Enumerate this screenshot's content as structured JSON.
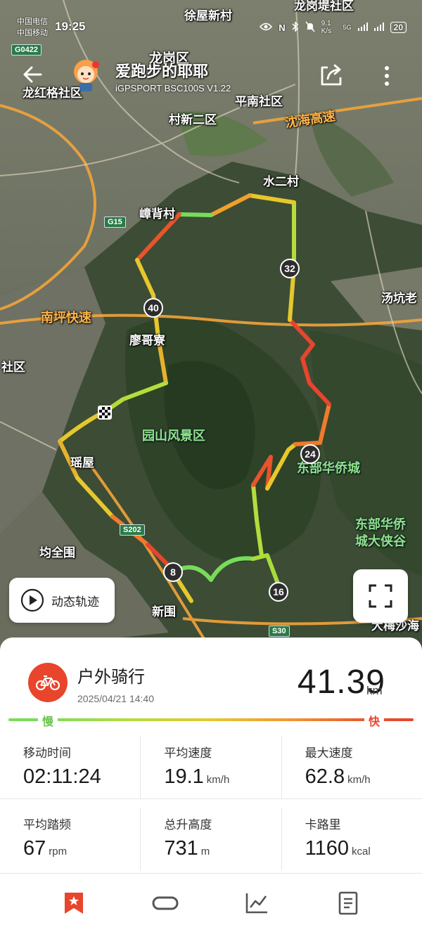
{
  "status_bar": {
    "carrier1": "中国电信",
    "carrier2": "中国移动",
    "time": "19:25",
    "net_speed": "9.1 K/s",
    "signal": "5G",
    "battery": "20"
  },
  "header": {
    "user_name": "爱跑步的耶耶",
    "device": "iGPSPORT BSC100S  V1.22"
  },
  "map": {
    "labels": [
      {
        "id": "xuwuxincun",
        "text": "徐屋新村",
        "style": "white"
      },
      {
        "id": "longgangdi",
        "text": "龙岗堤社区",
        "style": "white"
      },
      {
        "id": "longgangqu",
        "text": "龙岗区",
        "style": "white"
      },
      {
        "id": "longhongge",
        "text": "龙红格社区",
        "style": "white"
      },
      {
        "id": "pingnan",
        "text": "平南社区",
        "style": "white"
      },
      {
        "id": "cunxin",
        "text": "村新二区",
        "style": "white"
      },
      {
        "id": "shenhai",
        "text": "沈海高速",
        "style": "orange"
      },
      {
        "id": "shuiercun",
        "text": "水二村",
        "style": "white"
      },
      {
        "id": "zhangbeicun",
        "text": "嶂背村",
        "style": "white"
      },
      {
        "id": "nanping",
        "text": "南坪快速",
        "style": "orange"
      },
      {
        "id": "tangkeng",
        "text": "汤坑老",
        "style": "white"
      },
      {
        "id": "liaoge",
        "text": "廖哥寮",
        "style": "white"
      },
      {
        "id": "shequ",
        "text": "社区",
        "style": "white"
      },
      {
        "id": "yuanshan",
        "text": "园山风景区",
        "style": "green"
      },
      {
        "id": "fanwu",
        "text": "瑶屋",
        "style": "white"
      },
      {
        "id": "dongbuhq",
        "text": "东部华侨城",
        "style": "green"
      },
      {
        "id": "dongbuhq2a",
        "text": "东部华侨",
        "style": "green"
      },
      {
        "id": "dongbuhq2b",
        "text": "城大侠谷",
        "style": "green"
      },
      {
        "id": "junquanwei",
        "text": "均全围",
        "style": "white"
      },
      {
        "id": "xinwei",
        "text": "新围",
        "style": "white"
      },
      {
        "id": "dameisha",
        "text": "大梅沙海",
        "style": "white"
      }
    ],
    "shields": {
      "g0422": "G0422",
      "g15": "G15",
      "s202": "S202",
      "s30": "S30"
    },
    "km_markers": {
      "m8": "8",
      "m16": "16",
      "m24": "24",
      "m32": "32",
      "m40": "40"
    },
    "replay_label": "动态轨迹"
  },
  "summary": {
    "sport_type": "户外骑行",
    "datetime": "2025/04/21 14:40",
    "distance": "41.39",
    "distance_unit": "km",
    "speed_slow": "慢",
    "speed_fast": "快"
  },
  "stats": [
    {
      "label": "移动时间",
      "value": "02:11:24",
      "unit": ""
    },
    {
      "label": "平均速度",
      "value": "19.1",
      "unit": "km/h"
    },
    {
      "label": "最大速度",
      "value": "62.8",
      "unit": "km/h"
    },
    {
      "label": "平均踏频",
      "value": "67",
      "unit": "rpm"
    },
    {
      "label": "总升高度",
      "value": "731",
      "unit": "m"
    },
    {
      "label": "卡路里",
      "value": "1160",
      "unit": "kcal"
    }
  ],
  "colors": {
    "accent": "#e8452c",
    "slow": "#78dc5a",
    "fast": "#e8452c"
  },
  "bottom_nav": [
    "bookmark-icon",
    "loop-icon",
    "chart-icon",
    "document-icon"
  ]
}
